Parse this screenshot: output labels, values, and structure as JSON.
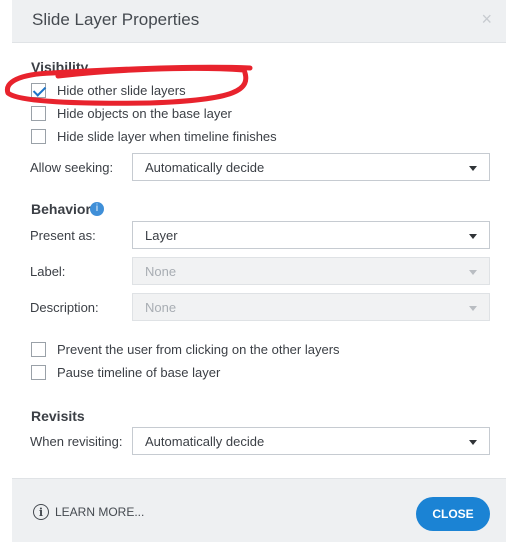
{
  "dialog": {
    "title": "Slide Layer Properties",
    "close_x": "×"
  },
  "visibility": {
    "heading": "Visibility",
    "options": [
      {
        "label": "Hide other slide layers",
        "checked": true
      },
      {
        "label": "Hide objects on the base layer",
        "checked": false
      },
      {
        "label": "Hide slide layer when timeline finishes",
        "checked": false
      }
    ],
    "allow_seeking": {
      "label": "Allow seeking:",
      "value": "Automatically decide"
    }
  },
  "behavior": {
    "heading": "Behavior",
    "info_icon": "i",
    "present_as": {
      "label": "Present as:",
      "value": "Layer"
    },
    "label_field": {
      "label": "Label:",
      "value": "None"
    },
    "description_field": {
      "label": "Description:",
      "value": "None"
    },
    "options": [
      {
        "label": "Prevent the user from clicking on the other layers",
        "checked": false
      },
      {
        "label": "Pause timeline of base layer",
        "checked": false
      }
    ]
  },
  "revisits": {
    "heading": "Revisits",
    "when_revisiting": {
      "label": "When revisiting:",
      "value": "Automatically decide"
    }
  },
  "footer": {
    "learn_more": "LEARN MORE...",
    "learn_icon": "i",
    "close": "CLOSE"
  },
  "colors": {
    "accent": "#1b83d4",
    "annotation": "#e8232d"
  }
}
